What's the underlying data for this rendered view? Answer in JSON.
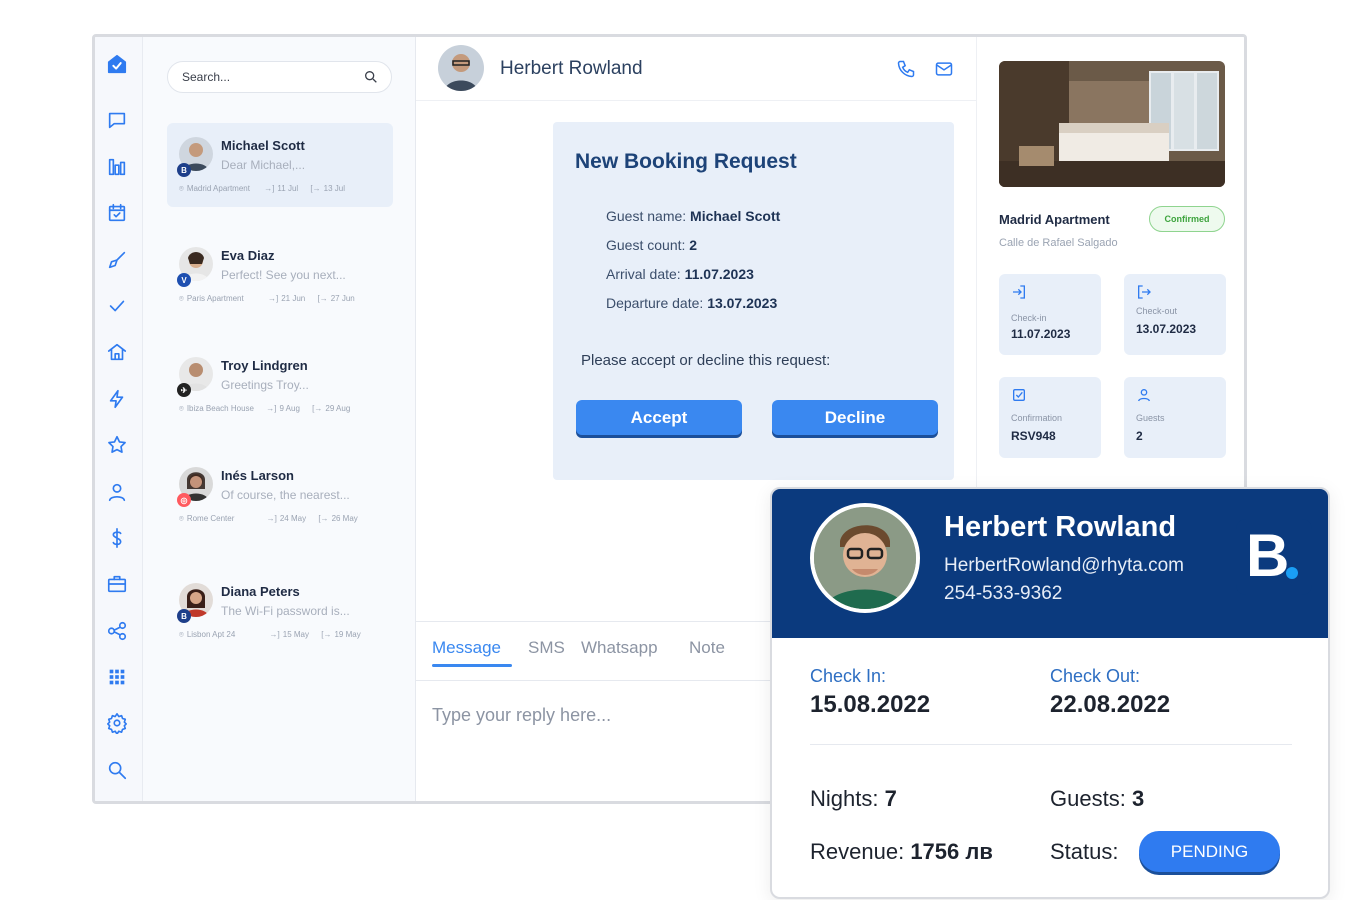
{
  "search": {
    "placeholder": "Search..."
  },
  "conversations": [
    {
      "name": "Michael Scott",
      "preview": "Dear Michael,...",
      "location": "Madrid Apartment",
      "checkin": "11 Jul",
      "checkout": "13 Jul",
      "badge": "B",
      "active": true
    },
    {
      "name": "Eva Diaz",
      "preview": "Perfect! See you next...",
      "location": "Paris Apartment",
      "checkin": "21 Jun",
      "checkout": "27 Jun",
      "badge": "V",
      "active": false
    },
    {
      "name": "Troy Lindgren",
      "preview": "Greetings Troy...",
      "location": "Ibiza Beach House",
      "checkin": "9 Aug",
      "checkout": "29 Aug",
      "badge": "",
      "active": false
    },
    {
      "name": "Inés Larson",
      "preview": "Of course, the nearest...",
      "location": "Rome Center",
      "checkin": "24 May",
      "checkout": "26 May",
      "badge": "",
      "active": false
    },
    {
      "name": "Diana Peters",
      "preview": "The Wi-Fi password is...",
      "location": "Lisbon Apt 24",
      "checkin": "15 May",
      "checkout": "19 May",
      "badge": "B",
      "active": false
    }
  ],
  "chat": {
    "contact_name": "Herbert Rowland",
    "booking": {
      "title": "New Booking Request",
      "guest_name_label": "Guest name:",
      "guest_name": "Michael Scott",
      "guest_count_label": "Guest count:",
      "guest_count": "2",
      "arrival_label": "Arrival date:",
      "arrival": "11.07.2023",
      "departure_label": "Departure date:",
      "departure": "13.07.2023",
      "prompt": "Please accept or decline this request:",
      "accept_label": "Accept",
      "decline_label": "Decline"
    },
    "tabs": [
      "Message",
      "SMS",
      "Whatsapp",
      "Note"
    ],
    "reply_placeholder": "Type your reply here..."
  },
  "property": {
    "name": "Madrid Apartment",
    "status": "Confirmed",
    "address": "Calle de Rafael Salgado",
    "checkin_label": "Check-in",
    "checkin": "11.07.2023",
    "checkout_label": "Check-out",
    "checkout": "13.07.2023",
    "confirmation_label": "Confirmation",
    "confirmation": "RSV948",
    "guests_label": "Guests",
    "guests": "2"
  },
  "guest_card": {
    "name": "Herbert Rowland",
    "email": "HerbertRowland@rhyta.com",
    "phone": "254-533-9362",
    "logo_letter": "B",
    "checkin_label": "Check In:",
    "checkin": "15.08.2022",
    "checkout_label": "Check Out:",
    "checkout": "22.08.2022",
    "nights_label": "Nights:",
    "nights": "7",
    "guests_label": "Guests:",
    "guests": "3",
    "revenue_label": "Revenue:",
    "revenue": "1756 лв",
    "status_label": "Status:",
    "status": "PENDING"
  },
  "colors": {
    "accent": "#3a88f0",
    "brand_navy": "#0b3a7e",
    "confirmed_green": "#3ea43e"
  }
}
